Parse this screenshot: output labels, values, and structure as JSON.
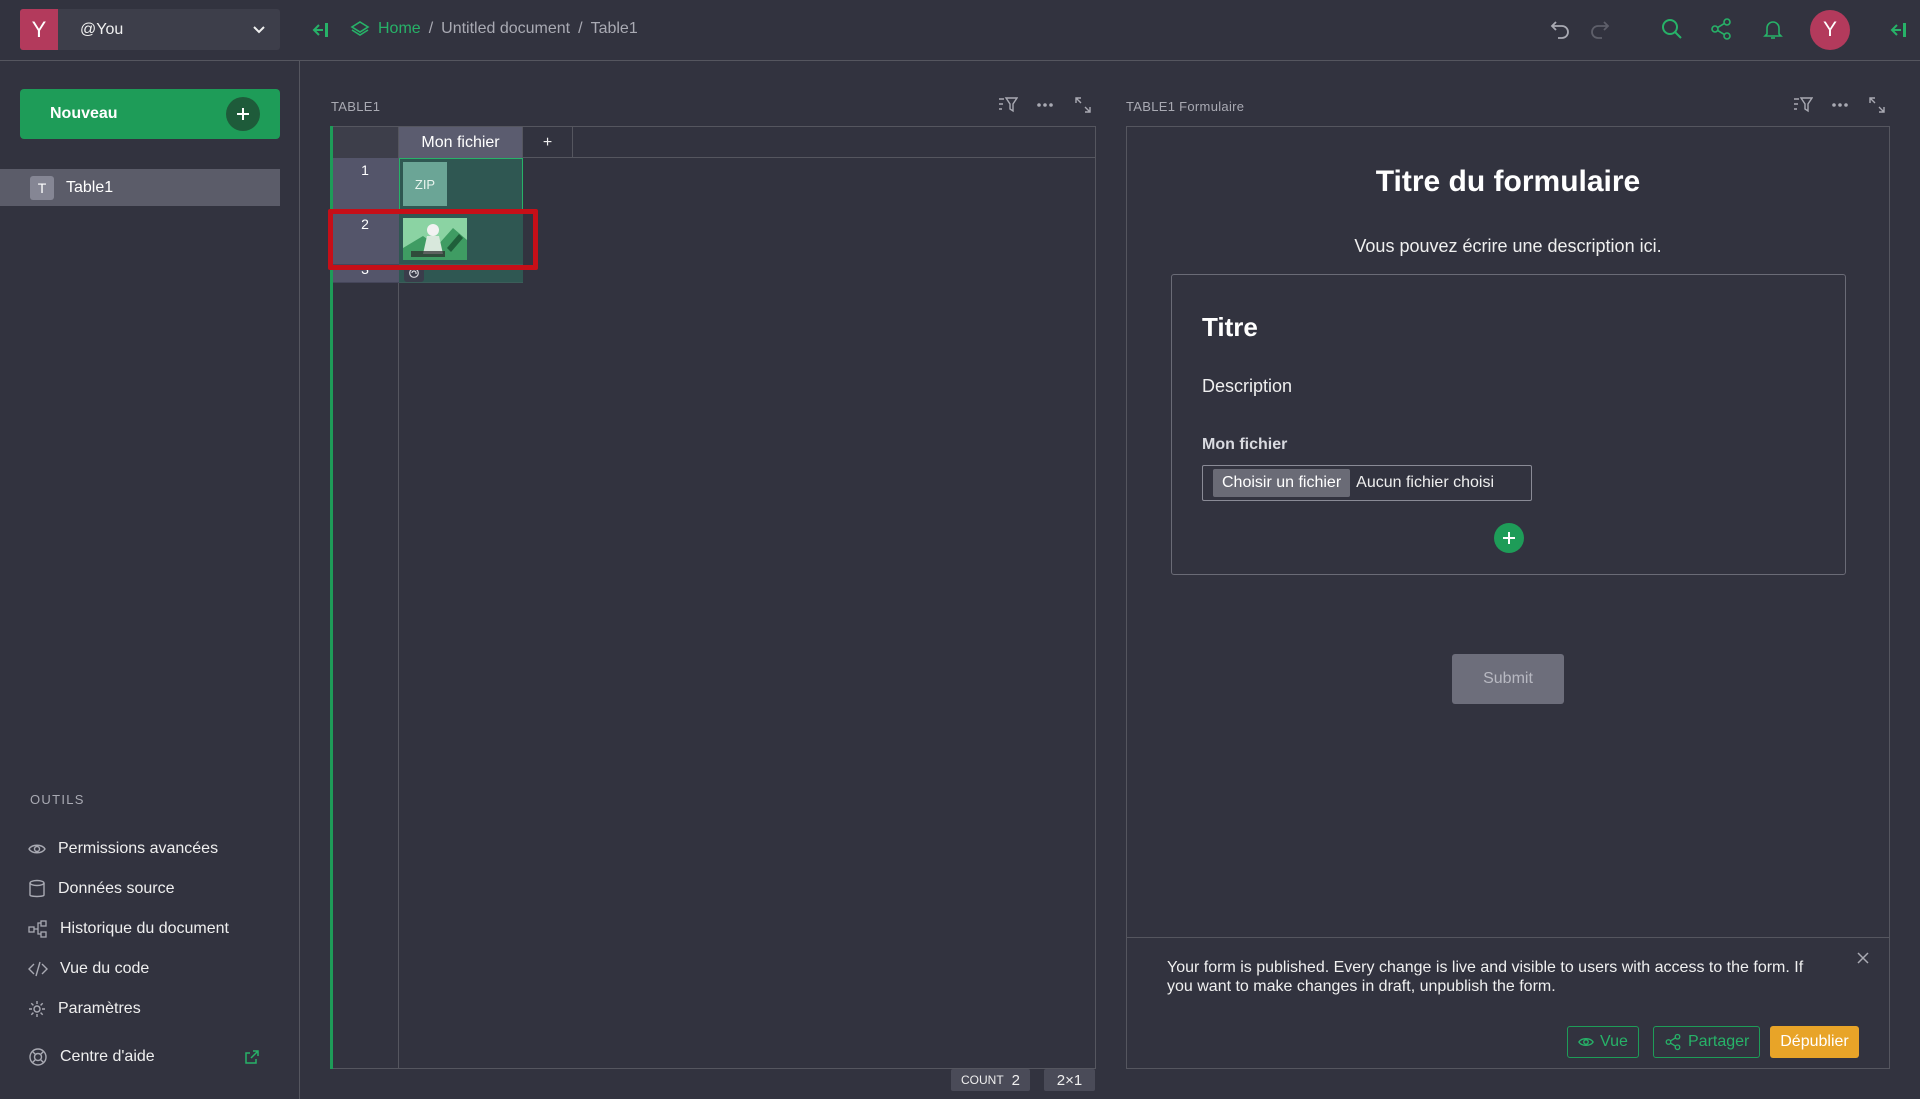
{
  "app": {
    "org_initial": "Y",
    "org_name": "@You",
    "avatar_initial": "Y"
  },
  "breadcrumb": {
    "home": "Home",
    "document": "Untitled document",
    "page": "Table1",
    "separator": "/"
  },
  "sidebar": {
    "new_button": "Nouveau",
    "pages": [
      {
        "badge": "T",
        "label": "Table1"
      }
    ],
    "tools_title": "OUTILS",
    "tools": [
      {
        "label": "Permissions avancées",
        "icon": "eye-icon"
      },
      {
        "label": "Données source",
        "icon": "database-icon"
      },
      {
        "label": "Historique du document",
        "icon": "history-icon"
      },
      {
        "label": "Vue du code",
        "icon": "code-icon"
      },
      {
        "label": "Paramètres",
        "icon": "gear-icon"
      }
    ],
    "help": "Centre d'aide"
  },
  "table_section": {
    "title": "TABLE1",
    "column": "Mon fichier",
    "add_column": "+",
    "rows": [
      {
        "num": "1",
        "content": "ZIP"
      },
      {
        "num": "2",
        "content": "image"
      },
      {
        "num": "3",
        "content": ""
      }
    ],
    "count_label": "COUNT",
    "count_value": "2",
    "dimension": "2×1"
  },
  "form_section": {
    "title": "TABLE1 Formulaire",
    "form_title": "Titre du formulaire",
    "form_description": "Vous pouvez écrire une description ici.",
    "section_title": "Titre",
    "section_description": "Description",
    "field_label": "Mon fichier",
    "file_button": "Choisir un fichier",
    "file_status": "Aucun fichier choisi",
    "submit": "Submit",
    "publish_message": "Your form is published. Every change is live and visible to users with access to the form. If you want to make changes in draft, unpublish the form.",
    "view_button": "Vue",
    "share_button": "Partager",
    "unpublish_button": "Dépublier"
  },
  "colors": {
    "accent": "#1e9c58",
    "brand": "#b33a5c",
    "warning": "#e8a428",
    "highlight": "#c60f18"
  }
}
